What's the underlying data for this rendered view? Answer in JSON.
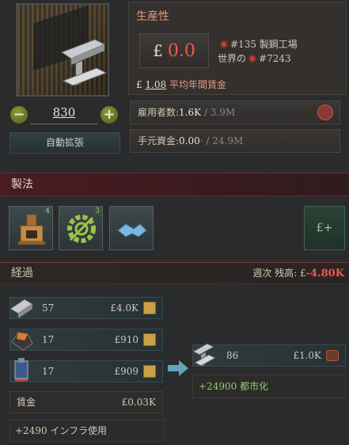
{
  "production": {
    "title": "生産性",
    "currency": "£",
    "value": "0.0",
    "rank_prefix": "#135",
    "rank_building": "製鋼工場",
    "world_prefix": "世界の",
    "world_rank": "#7243",
    "wage_value": "1.08",
    "wage_label": "平均年間賃金"
  },
  "level": {
    "minus": "−",
    "value": "830",
    "plus": "+",
    "auto_expand": "自動拡張"
  },
  "employment": {
    "label": "雇用者数:",
    "current": "1.6K",
    "max": "/ 3.9M"
  },
  "cash": {
    "label": "手元資金:",
    "current": "0.00",
    "sep": "·",
    "max": "/ 24.9M"
  },
  "methods": {
    "header": "製法",
    "buttons": [
      {
        "icon": "furnace-icon",
        "count": "4"
      },
      {
        "icon": "gear-automation-icon",
        "count": "3"
      },
      {
        "icon": "handshake-icon",
        "count": ""
      }
    ],
    "lp_label": "£+"
  },
  "flow": {
    "header": "経過",
    "weekly_label": "週次 残高:",
    "weekly_currency": "£",
    "weekly_value": "-4.80K",
    "inputs": [
      {
        "icon": "iron-ingot-icon",
        "count": "57",
        "price": "£4.0K"
      },
      {
        "icon": "coal-icon",
        "count": "17",
        "price": "£910"
      },
      {
        "icon": "tools-icon",
        "count": "17",
        "price": "£909"
      }
    ],
    "wage_label": "賃金",
    "wage_value": "£0.03K",
    "infra_value": "+2490",
    "infra_label": "インフラ使用",
    "output": {
      "icon": "steel-icon",
      "count": "86",
      "price": "£1.0K"
    },
    "urban_value": "+24900",
    "urban_label": "都市化"
  },
  "colors": {
    "negative": "#f05a48",
    "positive": "#8fcf6a",
    "accent_header": "#4a1b22"
  }
}
